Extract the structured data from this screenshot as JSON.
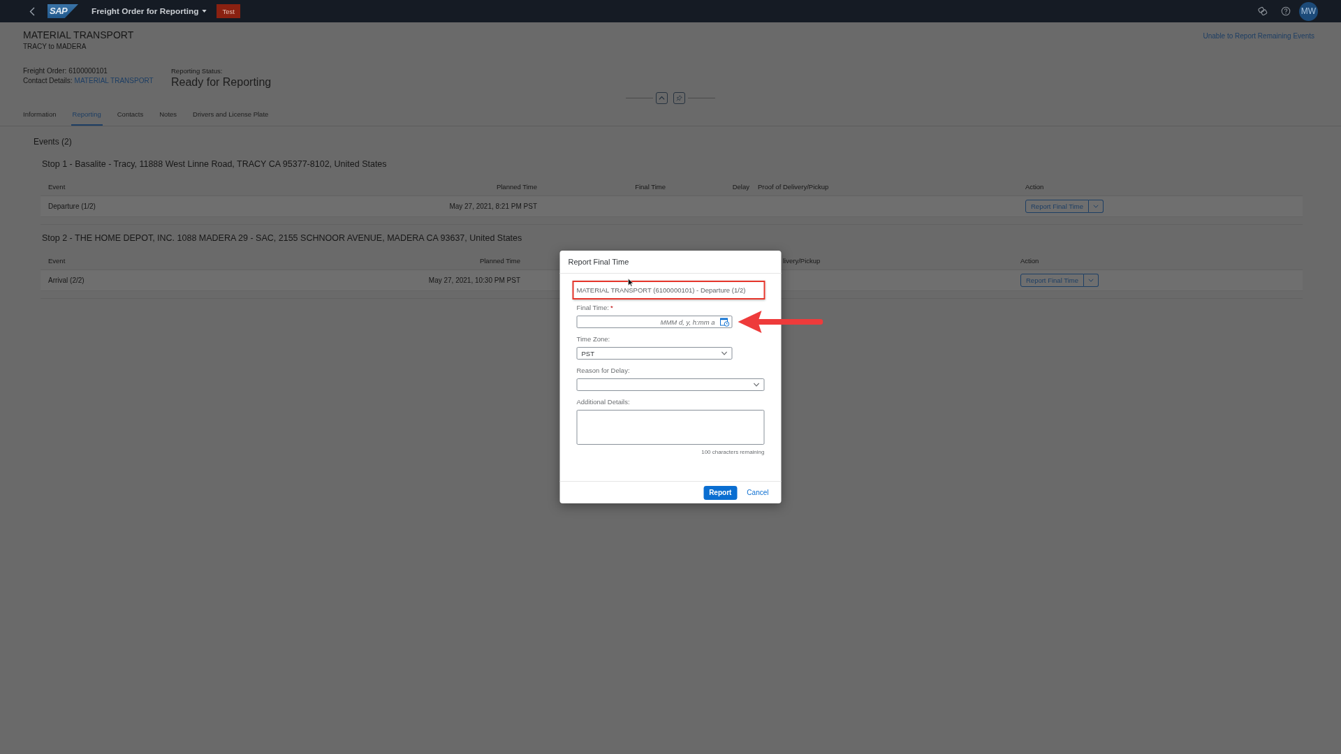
{
  "shell": {
    "logo": "SAP",
    "title": "Freight Order for Reporting",
    "badge": "Test",
    "avatar": "MW"
  },
  "header": {
    "title": "MATERIAL TRANSPORT",
    "subtitle": "TRACY to MADERA",
    "action_link": "Unable to Report Remaining Events",
    "attributes": [
      {
        "label": "Freight Order:",
        "value": "6100000101",
        "kind": "text"
      },
      {
        "label": "Contact Details:",
        "value": "MATERIAL TRANSPORT",
        "kind": "link"
      }
    ],
    "status": {
      "label": "Reporting Status:",
      "value": "Ready for Reporting"
    }
  },
  "tabs": [
    {
      "label": "Information",
      "selected": false
    },
    {
      "label": "Reporting",
      "selected": true
    },
    {
      "label": "Contacts",
      "selected": false
    },
    {
      "label": "Notes",
      "selected": false
    },
    {
      "label": "Drivers and License Plate",
      "selected": false
    }
  ],
  "events": {
    "title": "Events (2)",
    "stops": [
      {
        "title": "Stop 1 - Basalite - Tracy, 11888 West Linne Road, TRACY CA 95377-8102, United States",
        "columns": [
          "Event",
          "Planned Time",
          "Final Time",
          "Delay",
          "Proof of Delivery/Pickup",
          "Action"
        ],
        "rows": [
          {
            "event": "Departure (1/2)",
            "planned_time": "May 27, 2021, 8:21 PM PST",
            "action": "Report Final Time"
          }
        ]
      },
      {
        "title": "Stop 2 - THE HOME DEPOT, INC. 1088 MADERA 29 - SAC, 2155 SCHNOOR AVENUE, MADERA CA 93637, United States",
        "columns": [
          "Event",
          "Planned Time",
          "livery/Pickup",
          "Action"
        ],
        "rows": [
          {
            "event": "Arrival (2/2)",
            "planned_time": "May 27, 2021, 10:30 PM PST",
            "action": "Report Final Time"
          }
        ]
      }
    ]
  },
  "dialog": {
    "title": "Report Final Time",
    "heading": "MATERIAL TRANSPORT (6100000101) - Departure (1/2)",
    "heading_highlighted": true,
    "fields": [
      {
        "kind": "datetime",
        "label": "Final Time:",
        "required_mark": "*",
        "placeholder": "MMM d, y, h:mm a",
        "annotated": true
      },
      {
        "kind": "timezone",
        "label": "Time Zone:",
        "value": "PST"
      },
      {
        "kind": "select",
        "label": "Reason for Delay:"
      },
      {
        "kind": "textarea",
        "label": "Additional Details:",
        "counter": "100 characters remaining"
      }
    ],
    "buttons": [
      {
        "label": "Report",
        "kind": "emphasized"
      },
      {
        "label": "Cancel",
        "kind": "transparent"
      }
    ]
  }
}
